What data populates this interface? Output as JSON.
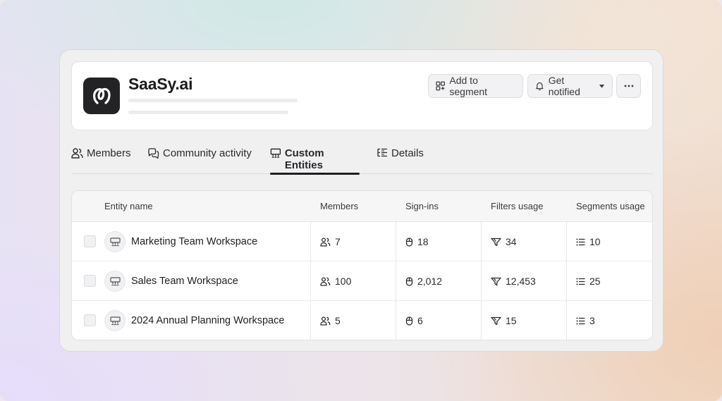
{
  "company": {
    "name": "SaaSy.ai"
  },
  "actions": {
    "add_segment": "Add to segment",
    "get_notified": "Get notified"
  },
  "tabs": [
    {
      "label": "Members",
      "icon": "users-icon",
      "active": false
    },
    {
      "label": "Community activity",
      "icon": "chat-bubbles-icon",
      "active": false
    },
    {
      "label": "Custom Entities",
      "icon": "entity-icon",
      "active": true
    },
    {
      "label": "Details",
      "icon": "list-details-icon",
      "active": false
    }
  ],
  "table": {
    "headers": [
      "Entity name",
      "Members",
      "Sign-ins",
      "Filters usage",
      "Segments usage"
    ],
    "rows": [
      {
        "name": "Marketing Team Workspace",
        "members": "7",
        "signins": "18",
        "filters": "34",
        "segments": "10"
      },
      {
        "name": "Sales Team Workspace",
        "members": "100",
        "signins": "2,012",
        "filters": "12,453",
        "segments": "25"
      },
      {
        "name": "2024 Annual Planning Workspace",
        "members": "5",
        "signins": "6",
        "filters": "15",
        "segments": "3"
      }
    ]
  },
  "colors": {
    "logo_bg": "#232325",
    "active_tab_underline": "#1f1f22"
  }
}
